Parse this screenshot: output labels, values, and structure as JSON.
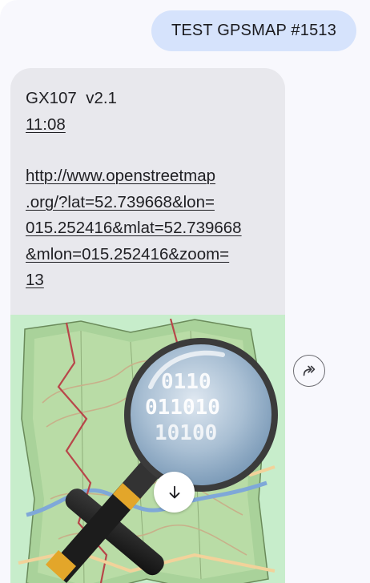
{
  "conversation": {
    "outgoing_message": {
      "text": "TEST GPSMAP #1513"
    },
    "incoming_message": {
      "header": "GX107  v2.1",
      "time": "11:08",
      "url_lines": [
        "http://www.openstreetmap",
        ".org/?lat=52.739668&lon=",
        "015.252416&mlat=52.739668",
        "&mlon=015.252416&zoom=",
        "13"
      ],
      "preview": {
        "icon": "openstreetmap-logo",
        "magnifier_text": "0110\n011010\n10100"
      }
    },
    "actions": {
      "forward_icon": "share-forward-icon",
      "download_icon": "arrow-down-icon"
    }
  },
  "colors": {
    "outgoing_bubble": "#d6e3fc",
    "incoming_bubble": "#e8e8ed",
    "background": "#f8f8fd"
  }
}
